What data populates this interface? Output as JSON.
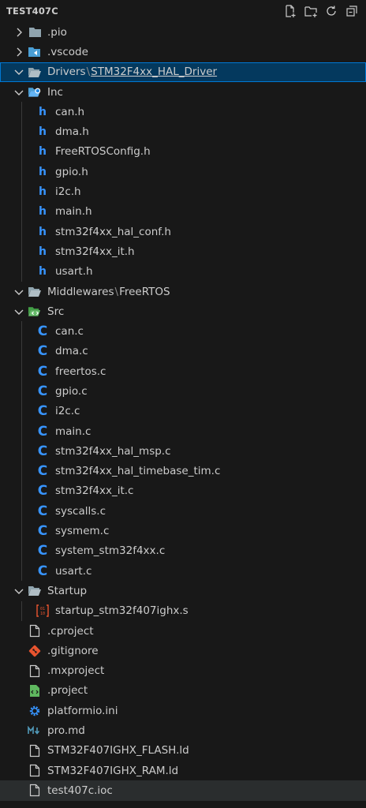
{
  "explorer": {
    "title": "TEST407C",
    "actions": [
      "new-file-icon",
      "new-folder-icon",
      "refresh-icon",
      "collapse-all-icon"
    ]
  },
  "tree": {
    "pio": ".pio",
    "vscode": ".vscode",
    "drivers": "Drivers",
    "drivers_sub": "STM32F4xx_HAL_Driver",
    "inc": "Inc",
    "inc_files": [
      "can.h",
      "dma.h",
      "FreeRTOSConfig.h",
      "gpio.h",
      "i2c.h",
      "main.h",
      "stm32f4xx_hal_conf.h",
      "stm32f4xx_it.h",
      "usart.h"
    ],
    "middlewares": "Middlewares",
    "middlewares_sub": "FreeRTOS",
    "src": "Src",
    "src_files": [
      "can.c",
      "dma.c",
      "freertos.c",
      "gpio.c",
      "i2c.c",
      "main.c",
      "stm32f4xx_hal_msp.c",
      "stm32f4xx_hal_timebase_tim.c",
      "stm32f4xx_it.c",
      "syscalls.c",
      "sysmem.c",
      "system_stm32f4xx.c",
      "usart.c"
    ],
    "startup": "Startup",
    "startup_file": "startup_stm32f407ighx.s",
    "root_files": [
      ".cproject",
      ".gitignore",
      ".mxproject",
      ".project",
      "platformio.ini",
      "pro.md",
      "STM32F407IGHX_FLASH.ld",
      "STM32F407IGHX_RAM.ld",
      "test407c.ioc"
    ]
  },
  "colors": {
    "background": "#181818",
    "selected_bg": "#04395e",
    "selected_border": "#0078d4",
    "c_h_icon": "#3794ff",
    "git_icon": "#e8542f",
    "project_icon": "#5fb85f",
    "gear_icon": "#3794ff",
    "md_icon": "#519aba"
  }
}
